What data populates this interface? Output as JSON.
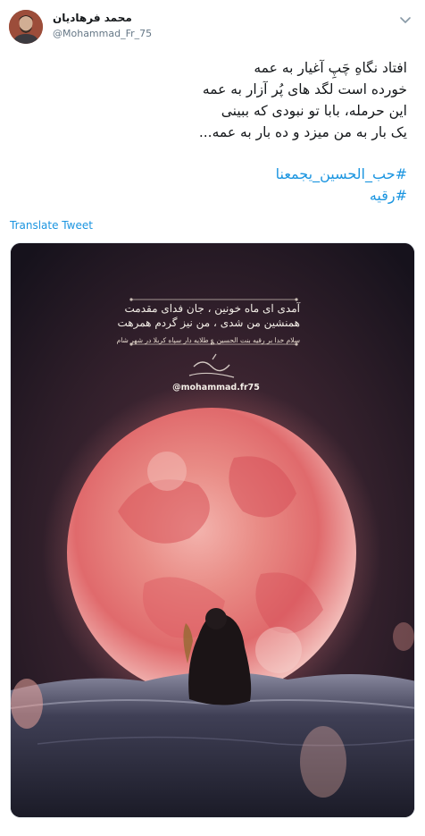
{
  "author": {
    "display_name": "محمد فرهادیان",
    "handle": "@Mohammad_Fr_75"
  },
  "icons": {
    "avatar": "profile-photo",
    "menu": "chevron-down-icon"
  },
  "tweet": {
    "lines": [
      "افتاد نگاهِ چَپِ آغیار  به عمه",
      "خورده است لگد های پُر آزار به عمه",
      "این حرمله، بابا تو نبودی که ببینی",
      "یک بار به من میزد و ده بار به  عمه..."
    ],
    "hashtags": [
      "#حب_الحسين_يجمعنا",
      "#رقیه"
    ],
    "translate_label": "Translate Tweet"
  },
  "media": {
    "poem_line_1": "آمدی ای ماه خونین ، جان فدای مقدمت",
    "poem_line_2": "همنشین من شدی ، من نیز گردم همرهت",
    "salam_line": "سلام خدا بر رقیه بنت الحسین ؏ طلایه دار سپاه کربلا در شهر شام",
    "signature_logo": "دل نوشته حسینی",
    "watermark": "@mohammad.fr75"
  },
  "colors": {
    "link": "#1b95e0",
    "handle": "#657786",
    "text": "#14171a",
    "moon": "#e0535a"
  }
}
